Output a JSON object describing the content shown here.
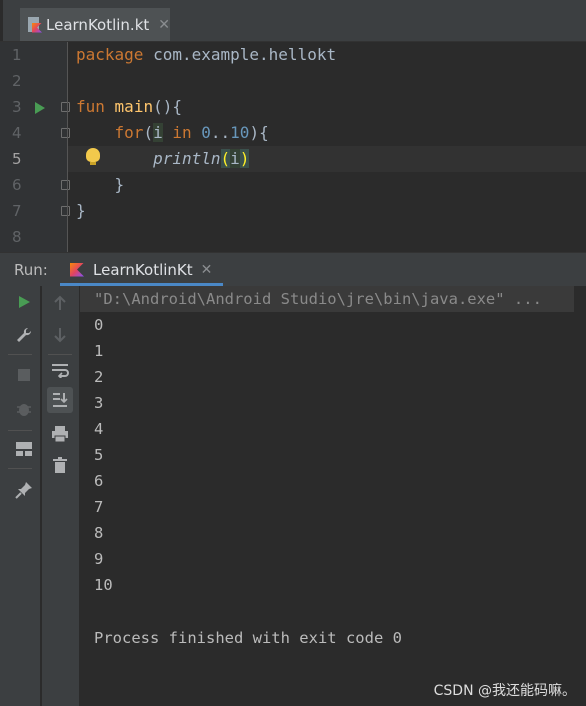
{
  "editor_tab": {
    "label": "LearnKotlin.kt",
    "close": "✕"
  },
  "gutter": {
    "line_numbers": [
      "1",
      "2",
      "3",
      "4",
      "5",
      "6",
      "7",
      "8"
    ]
  },
  "code": {
    "line1_kw": "package",
    "line1_rest": " com.example.hellokt",
    "line3_kw": "fun",
    "line3_fn": "main",
    "line3_rest": "(){",
    "line4_kw": "for",
    "line4_p1": "(",
    "line4_var": "i",
    "line4_in": "in",
    "line4_range_start": "0",
    "line4_range_op": "..",
    "line4_range_end": "10",
    "line4_rest": "){",
    "line5_fn": "println",
    "line5_open": "(",
    "line5_arg": "i",
    "line5_close": ")",
    "line6": "}",
    "line7": "}"
  },
  "run_panel": {
    "label": "Run:",
    "tab_label": "LearnKotlinKt",
    "tab_close": "✕",
    "command": "\"D:\\Android\\Android Studio\\jre\\bin\\java.exe\" ...",
    "output": [
      "0",
      "1",
      "2",
      "3",
      "4",
      "5",
      "6",
      "7",
      "8",
      "9",
      "10"
    ],
    "finish": "Process finished with exit code 0"
  },
  "toolbar_icons": [
    "run-icon",
    "wrench-icon",
    "stop-icon",
    "bug-icon",
    "layout-icon",
    "pin-icon",
    "up-arrow-icon",
    "down-arrow-icon",
    "soft-wrap-icon",
    "scroll-to-end-icon",
    "print-icon",
    "trash-icon"
  ],
  "watermark": "CSDN @我还能码嘛。",
  "colors": {
    "keyword": "#cc7832",
    "function": "#ffc66d",
    "number": "#6897bb",
    "text": "#a9b7c6",
    "run_green": "#499c54",
    "accent": "#4a88c7"
  }
}
